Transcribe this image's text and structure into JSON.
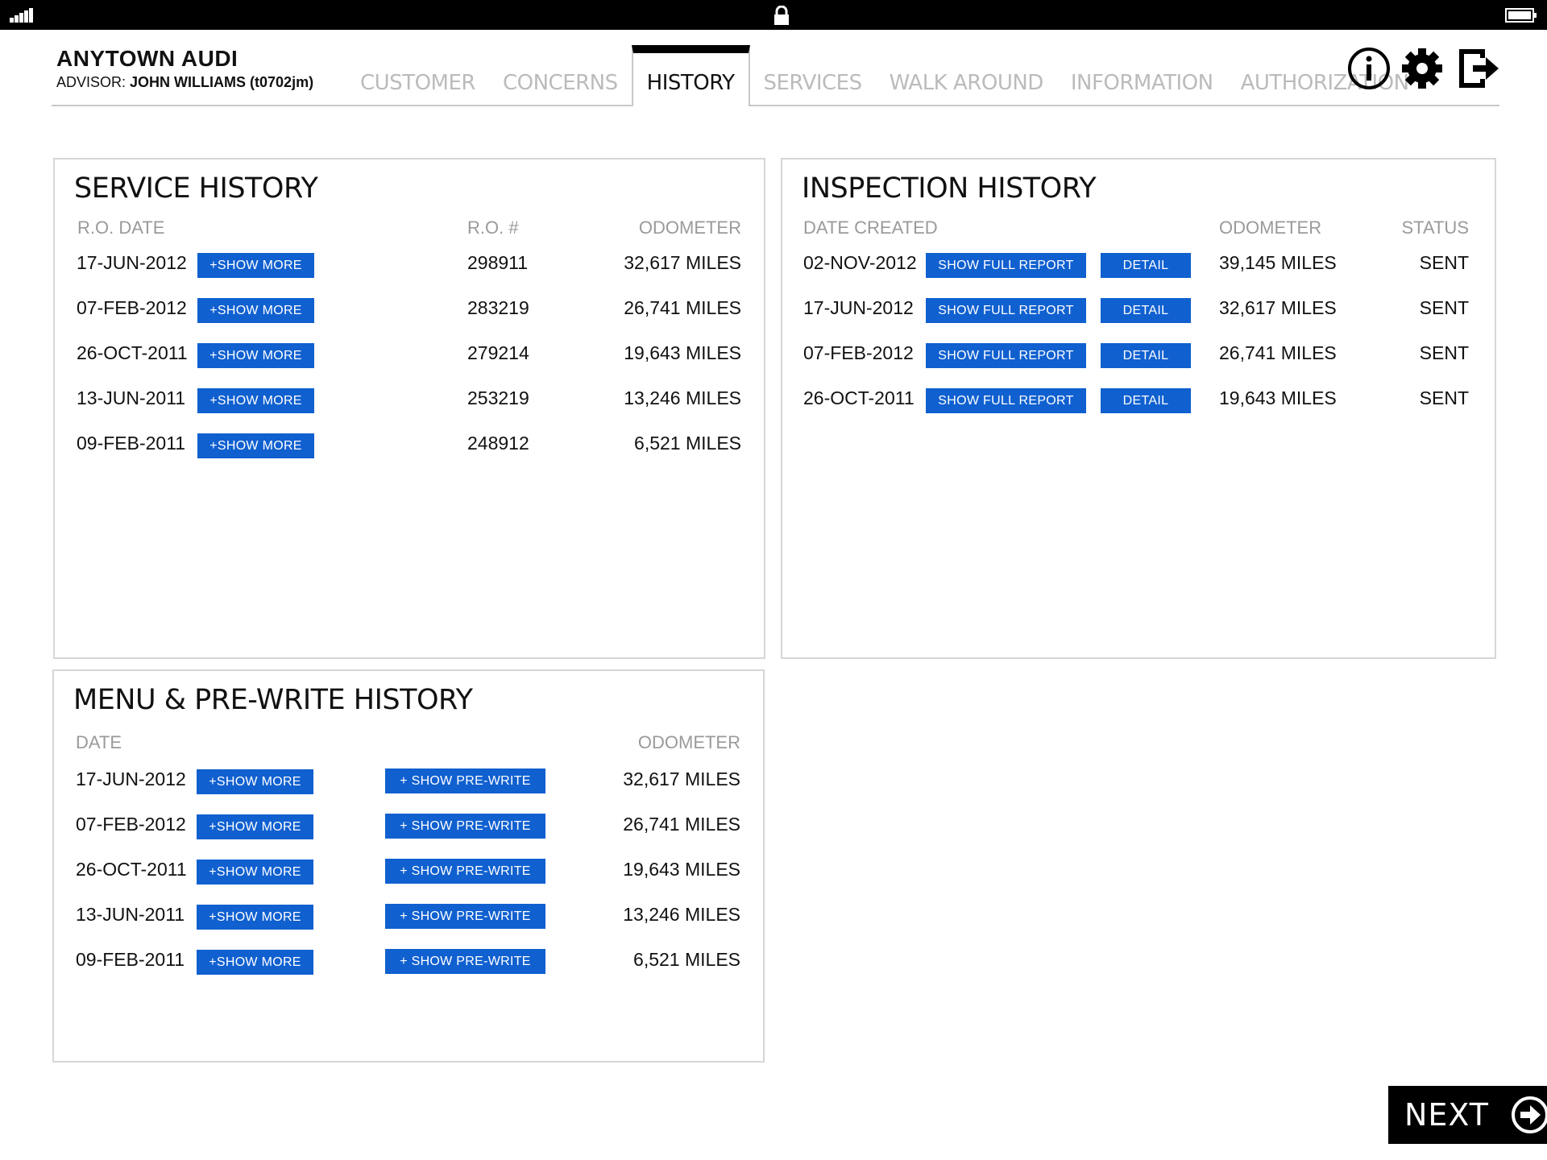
{
  "header": {
    "dealer": "ANYTOWN AUDI",
    "advisor_label": "ADVISOR:",
    "advisor_name": "JOHN WILLIAMS (t0702jm)"
  },
  "tabs": [
    {
      "label": "CUSTOMER",
      "active": false
    },
    {
      "label": "CONCERNS",
      "active": false
    },
    {
      "label": "HISTORY",
      "active": true
    },
    {
      "label": "SERVICES",
      "active": false
    },
    {
      "label": "WALK AROUND",
      "active": false
    },
    {
      "label": "INFORMATION",
      "active": false
    },
    {
      "label": "AUTHORIZATION",
      "active": false
    }
  ],
  "header_icons": [
    "info-icon",
    "gear-icon",
    "logout-icon"
  ],
  "colors": {
    "accent": "#1060d0",
    "status_bar": "#000000",
    "muted": "#9a9a9a"
  },
  "service_history": {
    "title": "SERVICE HISTORY",
    "columns": {
      "date": "R.O. DATE",
      "ro": "R.O. #",
      "odometer": "ODOMETER"
    },
    "button_label": "+SHOW MORE",
    "rows": [
      {
        "date": "17-JUN-2012",
        "ro": "298911",
        "odometer": "32,617 MILES"
      },
      {
        "date": "07-FEB-2012",
        "ro": "283219",
        "odometer": "26,741 MILES"
      },
      {
        "date": "26-OCT-2011",
        "ro": "279214",
        "odometer": "19,643 MILES"
      },
      {
        "date": "13-JUN-2011",
        "ro": "253219",
        "odometer": "13,246 MILES"
      },
      {
        "date": "09-FEB-2011",
        "ro": "248912",
        "odometer": "6,521 MILES"
      }
    ]
  },
  "inspection_history": {
    "title": "INSPECTION HISTORY",
    "columns": {
      "date": "DATE CREATED",
      "odometer": "ODOMETER",
      "status": "STATUS"
    },
    "report_label": "SHOW FULL REPORT",
    "detail_label": "DETAIL",
    "rows": [
      {
        "date": "02-NOV-2012",
        "odometer": "39,145 MILES",
        "status": "SENT"
      },
      {
        "date": "17-JUN-2012",
        "odometer": "32,617 MILES",
        "status": "SENT"
      },
      {
        "date": "07-FEB-2012",
        "odometer": "26,741 MILES",
        "status": "SENT"
      },
      {
        "date": "26-OCT-2011",
        "odometer": "19,643 MILES",
        "status": "SENT"
      }
    ]
  },
  "menu_history": {
    "title": "MENU & PRE-WRITE HISTORY",
    "columns": {
      "date": "DATE",
      "odometer": "ODOMETER"
    },
    "more_label": "+SHOW MORE",
    "prewrite_label": "+ SHOW PRE-WRITE",
    "rows": [
      {
        "date": "17-JUN-2012",
        "odometer": "32,617 MILES"
      },
      {
        "date": "07-FEB-2012",
        "odometer": "26,741 MILES"
      },
      {
        "date": "26-OCT-2011",
        "odometer": "19,643 MILES"
      },
      {
        "date": "13-JUN-2011",
        "odometer": "13,246 MILES"
      },
      {
        "date": "09-FEB-2011",
        "odometer": "6,521 MILES"
      }
    ]
  },
  "next": {
    "label": "NEXT"
  }
}
